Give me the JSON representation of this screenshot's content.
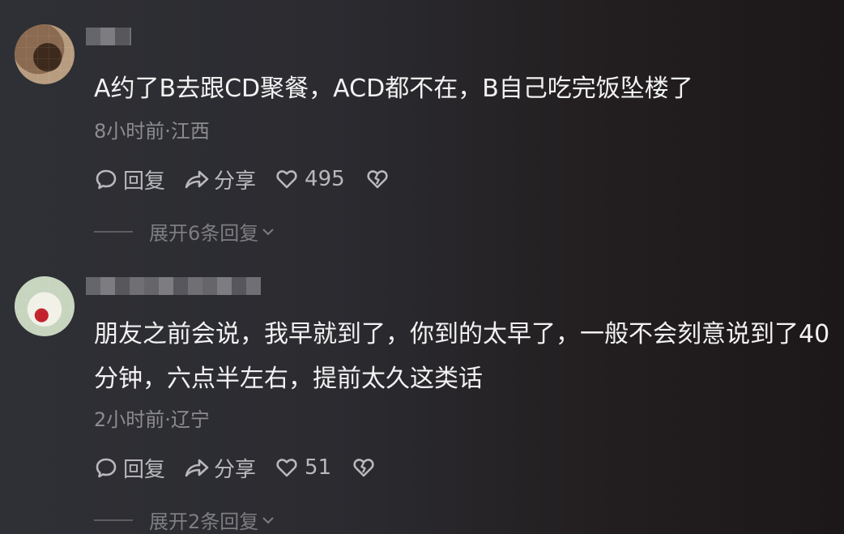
{
  "comments": [
    {
      "text": "A约了B去跟CD聚餐，ACD都不在，B自己吃完饭坠楼了",
      "meta": "8小时前·江西",
      "reply_label": "回复",
      "share_label": "分享",
      "likes": "495",
      "expand_label": "展开6条回复"
    },
    {
      "text": "朋友之前会说，我早就到了，你到的太早了，一般不会刻意说到了40分钟，六点半左右，提前太久这类话",
      "meta": "2小时前·辽宁",
      "reply_label": "回复",
      "share_label": "分享",
      "likes": "51",
      "expand_label": "展开2条回复"
    }
  ],
  "icons": {
    "reply": "chat-bubble-icon",
    "share": "share-arrow-icon",
    "like": "heart-icon",
    "dislike": "broken-heart-icon",
    "expand": "chevron-down-icon"
  },
  "colors": {
    "background": "#2b2b30",
    "text": "#f2f2f2",
    "meta": "#8d8d90",
    "action": "#b9b9bc"
  }
}
